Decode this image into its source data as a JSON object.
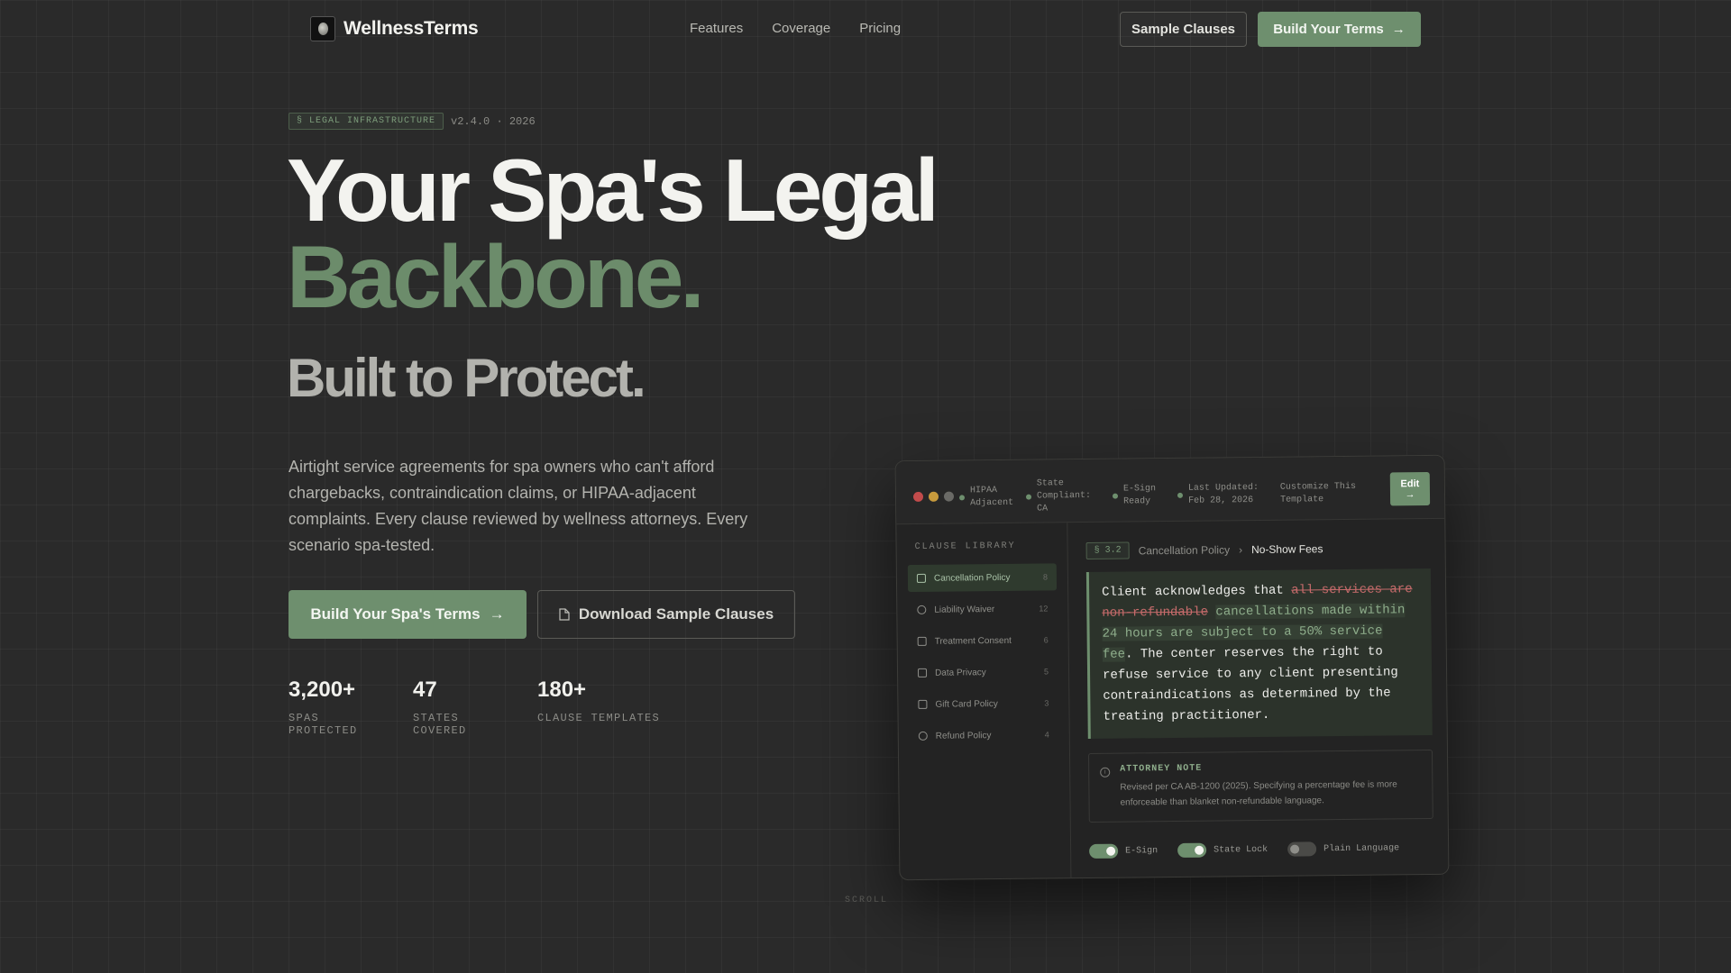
{
  "nav": {
    "brand": "WellnessTerms",
    "links": [
      "Features",
      "Coverage",
      "Pricing"
    ],
    "sample_clauses": "Sample Clauses",
    "build_terms": "Build Your Terms"
  },
  "hero": {
    "badge": "§ LEGAL INFRASTRUCTURE",
    "version": "v2.4.0 · 2026",
    "title_line1": "Your Spa's Legal",
    "title_line2": "Backbone.",
    "subtitle": "Built to Protect.",
    "lead": "Airtight service agreements for spa owners who can't afford chargebacks, contraindication claims, or HIPAA-adjacent complaints. Every clause reviewed by wellness attorneys. Every scenario spa-tested.",
    "cta_primary": "Build Your Spa's Terms",
    "cta_secondary": "Download Sample Clauses",
    "stats": [
      {
        "value": "3,200+",
        "label": "SPAS PROTECTED"
      },
      {
        "value": "47",
        "label": "STATES COVERED"
      },
      {
        "value": "180+",
        "label": "CLAUSE TEMPLATES"
      }
    ],
    "scroll": "SCROLL"
  },
  "app": {
    "status": {
      "hipaa": "HIPAA Adjacent",
      "state": "State Compliant: CA",
      "esign": "E-Sign Ready",
      "updated": "Last Updated: Feb 28, 2026",
      "customize": "Customize This Template"
    },
    "edit": "Edit",
    "sidebar_title": "CLAUSE LIBRARY",
    "sidebar": [
      {
        "label": "Cancellation Policy",
        "count": "8"
      },
      {
        "label": "Liability Waiver",
        "count": "12"
      },
      {
        "label": "Treatment Consent",
        "count": "6"
      },
      {
        "label": "Data Privacy",
        "count": "5"
      },
      {
        "label": "Gift Card Policy",
        "count": "3"
      },
      {
        "label": "Refund Policy",
        "count": "4"
      }
    ],
    "breadcrumb": {
      "section": "§ 3.2",
      "parent": "Cancellation Policy",
      "current": "No-Show Fees"
    },
    "clause": {
      "lead": "Client acknowledges that ",
      "removed": "all services are non-refundable",
      "added": "cancellations made within 24 hours are subject to a 50% service fee",
      "rest": ". The center reserves the right to refuse service to any client presenting contraindications as determined by the treating practitioner."
    },
    "note": {
      "title": "ATTORNEY NOTE",
      "text": "Revised per CA AB-1200 (2025). Specifying a percentage fee is more enforceable than blanket non-refundable language."
    },
    "toggles": [
      {
        "label": "E-Sign",
        "on": true
      },
      {
        "label": "State Lock",
        "on": true
      },
      {
        "label": "Plain Language",
        "on": false
      }
    ]
  },
  "colors": {
    "accent": "#6e8f6e",
    "background": "#2a2a2a",
    "strike": "#c66b6b"
  }
}
